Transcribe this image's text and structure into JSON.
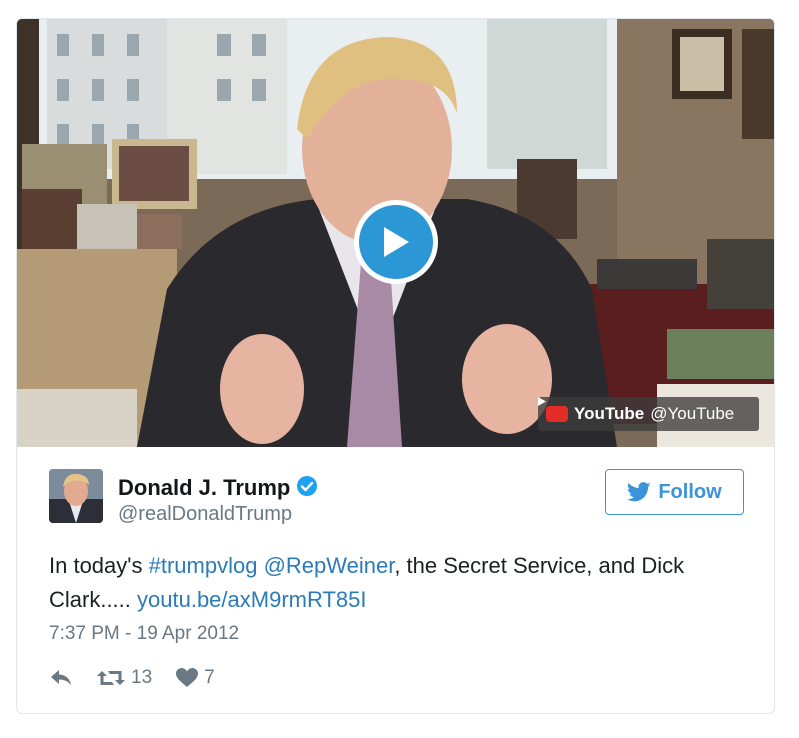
{
  "video": {
    "source_brand": "YouTube",
    "source_handle": "@YouTube",
    "play_icon": "play-icon"
  },
  "author": {
    "name": "Donald J. Trump",
    "handle": "@realDonaldTrump",
    "verified": true
  },
  "follow_label": "Follow",
  "tweet": {
    "text_intro": "In today's ",
    "hashtag": "#trumpvlog",
    "space1": " ",
    "mention": "@RepWeiner",
    "text_rest": ", the Secret Service, and Dick Clark..... ",
    "link": "youtu.be/axM9rmRT85I"
  },
  "timestamp": "7:37 PM - 19 Apr 2012",
  "actions": {
    "retweets": "13",
    "likes": "7"
  },
  "colors": {
    "accent": "#3b94d9",
    "link": "#2b7bb9",
    "muted": "#697882",
    "play": "#2b98d5"
  }
}
